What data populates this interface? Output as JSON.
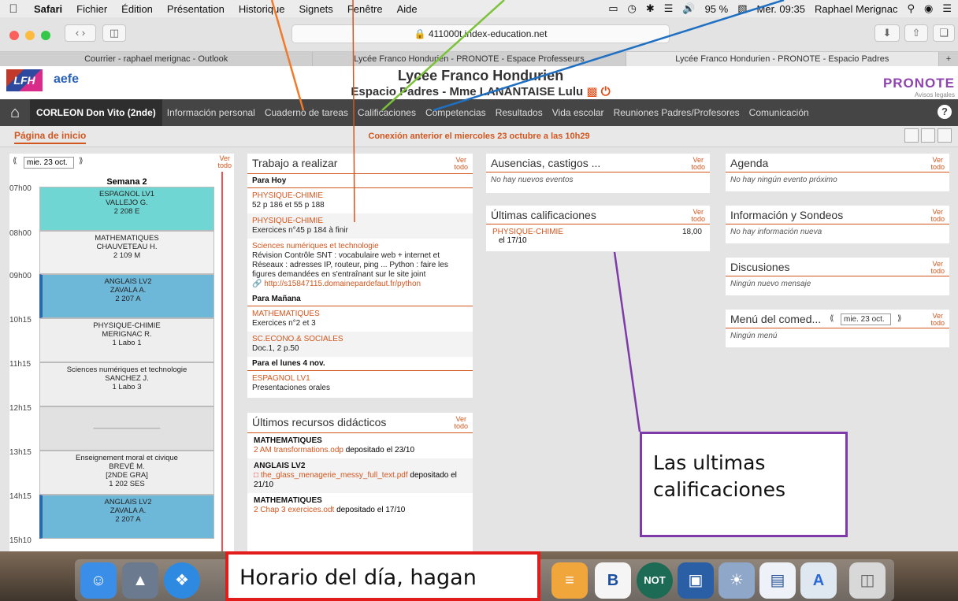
{
  "menubar": {
    "apple": "",
    "items": [
      "Safari",
      "Fichier",
      "Édition",
      "Présentation",
      "Historique",
      "Signets",
      "Fenêtre",
      "Aide"
    ],
    "battery": "95 %",
    "clock": "Mer. 09:35",
    "user": "Raphael Merignac"
  },
  "browser": {
    "url": "411000t.index-education.net",
    "tabs": [
      "Courrier - raphael merignac - Outlook",
      "Lycée Franco Hondurien - PRONOTE - Espace Professeurs",
      "Lycée Franco Hondurien - PRONOTE - Espacio Padres"
    ],
    "new_tab": "+"
  },
  "header": {
    "logo_text": "LFH",
    "aefe": "aefe",
    "school_title": "Lycée Franco Hondurien",
    "space_title": "Espacio Padres - Mme LANANTAISE Lulu",
    "pronote": "PRONOTE",
    "avisos": "Avisos legales"
  },
  "nav": {
    "student": "CORLEON Don Vito (2nde)",
    "items": [
      "Información personal",
      "Cuaderno de tareas",
      "Calificaciones",
      "Competencias",
      "Resultados",
      "Vida escolar",
      "Reuniones Padres/Profesores",
      "Comunicación"
    ],
    "help": "?"
  },
  "subbar": {
    "home_tab": "Página de inicio",
    "connection": "Conexión anterior el miercoles 23 octubre a las 10h29"
  },
  "ver_todo": [
    "Ver",
    "todo"
  ],
  "timetable": {
    "date": "mie. 23 oct.",
    "week": "Semana 2",
    "hours": [
      "07h00",
      "08h00",
      "09h00",
      "10h15",
      "11h15",
      "12h15",
      "13h15",
      "14h15",
      "15h10"
    ],
    "courses": [
      {
        "lines": [
          "ESPAGNOL LV1",
          "VALLEJO G.",
          "2 208 E"
        ]
      },
      {
        "lines": [
          "MATHEMATIQUES",
          "CHAUVETEAU H.",
          "2 109 M"
        ]
      },
      {
        "lines": [
          "ANGLAIS LV2",
          "ZAVALA A.",
          "2 207 A"
        ]
      },
      {
        "lines": [
          "PHYSIQUE-CHIMIE",
          "MERIGNAC R.",
          "1 Labo 1"
        ]
      },
      {
        "lines": [
          "Sciences numériques et technologie",
          "SANCHEZ J.",
          "1 Labo 3"
        ]
      },
      {
        "lines": [
          "________________"
        ]
      },
      {
        "lines": [
          "Enseignement moral et civique",
          "BREVÉ M.",
          "[2NDE GRA]",
          "1 202 SES"
        ]
      },
      {
        "lines": [
          "ANGLAIS LV2",
          "ZAVALA A.",
          "2 207 A"
        ]
      }
    ]
  },
  "trabajo": {
    "title": "Trabajo a realizar",
    "sections": [
      {
        "heading": "Para Hoy",
        "items": [
          {
            "subject": "PHYSIQUE-CHIMIE",
            "text": "52 p 186 et 55 p 188"
          },
          {
            "subject": "PHYSIQUE-CHIMIE",
            "text": "Exercices n°45 p 184 à finir"
          },
          {
            "subject": "Sciences numériques et technologie",
            "text": "Révision Contrôle SNT : vocabulaire web + internet et Réseaux : adresses IP, routeur, ping ... Python : faire les figures demandées en s'entraînant sur le site joint",
            "link": "http://s15847115.domainepardefaut.fr/python"
          }
        ]
      },
      {
        "heading": "Para Mañana",
        "items": [
          {
            "subject": "MATHEMATIQUES",
            "text": "Exercices n°2 et 3"
          },
          {
            "subject": "SC.ECONO.& SOCIALES",
            "text": "Doc.1, 2 p.50"
          }
        ]
      },
      {
        "heading": "Para el lunes 4 nov.",
        "items": [
          {
            "subject": "ESPAGNOL LV1",
            "text": "Presentaciones orales"
          }
        ]
      }
    ]
  },
  "recursos": {
    "title": "Últimos recursos didácticos",
    "items": [
      {
        "subject": "MATHEMATIQUES",
        "link": "2 AM transformations.odp",
        "text": "depositado el 23/10"
      },
      {
        "subject": "ANGLAIS LV2",
        "link": "the_glass_menagerie_messy_full_text.pdf",
        "text": "depositado el 21/10"
      },
      {
        "subject": "MATHEMATIQUES",
        "link": "2 Chap 3 exercices.odt",
        "text": "depositado el 17/10"
      }
    ]
  },
  "ausencias": {
    "title": "Ausencias, castigos ...",
    "empty": "No hay nuevos eventos"
  },
  "calificaciones": {
    "title": "Últimas calificaciones",
    "subject": "PHYSIQUE-CHIMIE",
    "date": "el 17/10",
    "value": "18,00"
  },
  "agenda": {
    "title": "Agenda",
    "empty": "No hay ningún evento próximo"
  },
  "info": {
    "title": "Información y Sondeos",
    "empty": "No hay información nueva"
  },
  "discusiones": {
    "title": "Discusiones",
    "empty": "Ningún nuevo mensaje"
  },
  "menu": {
    "title": "Menú del comed...",
    "date": "mie. 23 oct.",
    "empty": "Ningún menú"
  },
  "annotations": {
    "callout_purple": "Las ultimas calificaciones",
    "callout_red": "Horario del día, hagan",
    "arrow_colors": [
      "#f07a2a",
      "#7cc23a",
      "#1f6fc2",
      "#d2561e"
    ]
  },
  "dock": {
    "items": [
      "Finder",
      "Launchpad",
      "Safari",
      "Calendar",
      "Calculator",
      "B",
      "NOT",
      "VirtualBox",
      "Preview",
      "Word",
      "Trash"
    ]
  }
}
